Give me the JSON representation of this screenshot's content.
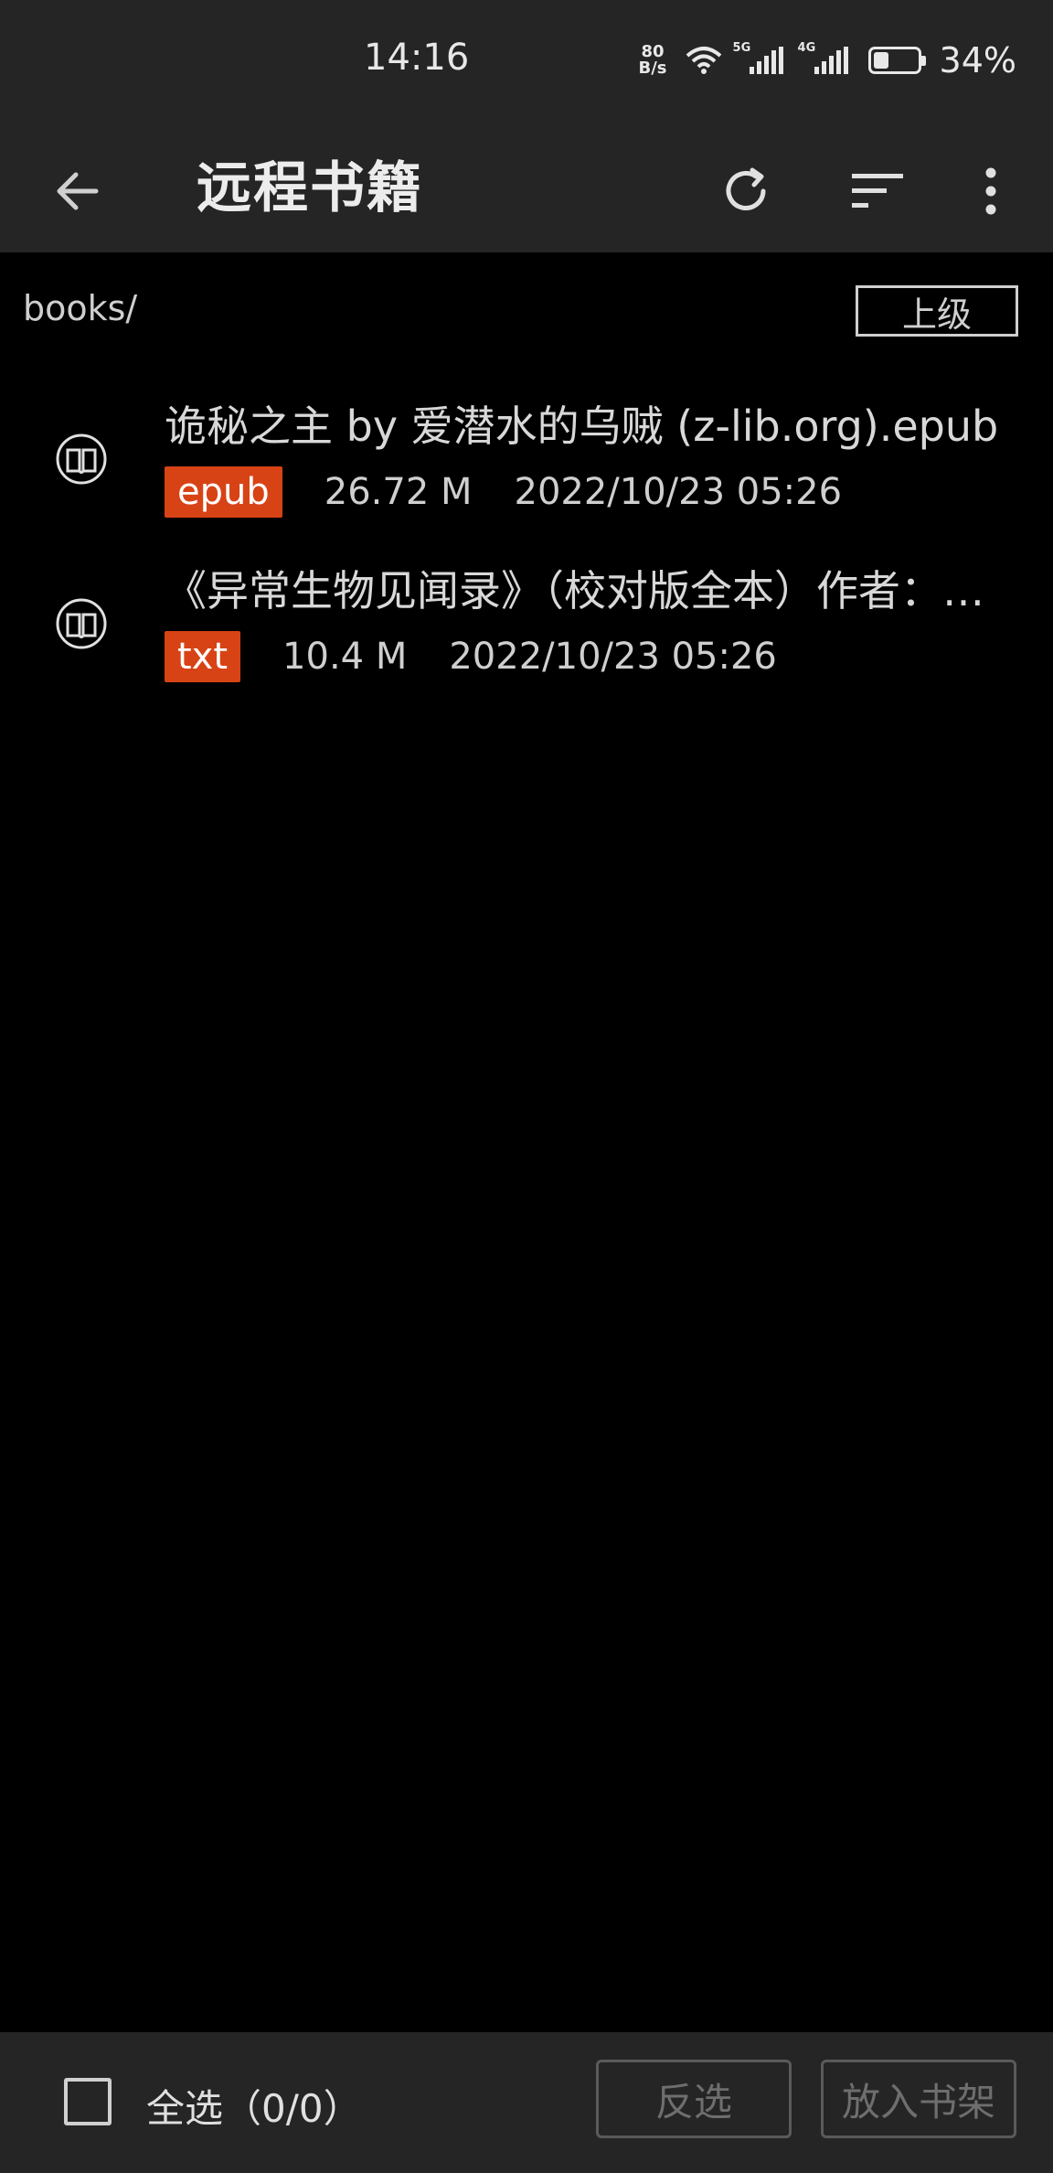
{
  "status_bar": {
    "time": "14:16",
    "net_speed_value": "80",
    "net_speed_unit": "B/s",
    "sim1_label": "5G",
    "sim2_label": "4G",
    "battery_percent": "34%",
    "battery_level": 0.34
  },
  "toolbar": {
    "title": "远程书籍",
    "back_icon": "arrow-left-icon",
    "refresh_icon": "refresh-icon",
    "sort_icon": "sort-icon",
    "more_icon": "more-vert-icon"
  },
  "path": {
    "current": "books/",
    "up_label": "上级"
  },
  "files": [
    {
      "name": "诡秘之主 by 爱潜水的乌贼 (z-lib.org).epub",
      "type": "epub",
      "size": "26.72 M",
      "date": "2022/10/23 05:26"
    },
    {
      "name": "《异常生物见闻录》（校对版全本）作者：…",
      "type": "txt",
      "size": "10.4 M",
      "date": "2022/10/23 05:26"
    }
  ],
  "bottom_bar": {
    "select_all_label": "全选（0/0）",
    "invert_label": "反选",
    "add_to_shelf_label": "放入书架"
  },
  "colors": {
    "background": "#000000",
    "bars": "#252525",
    "badge": "#d84315"
  }
}
